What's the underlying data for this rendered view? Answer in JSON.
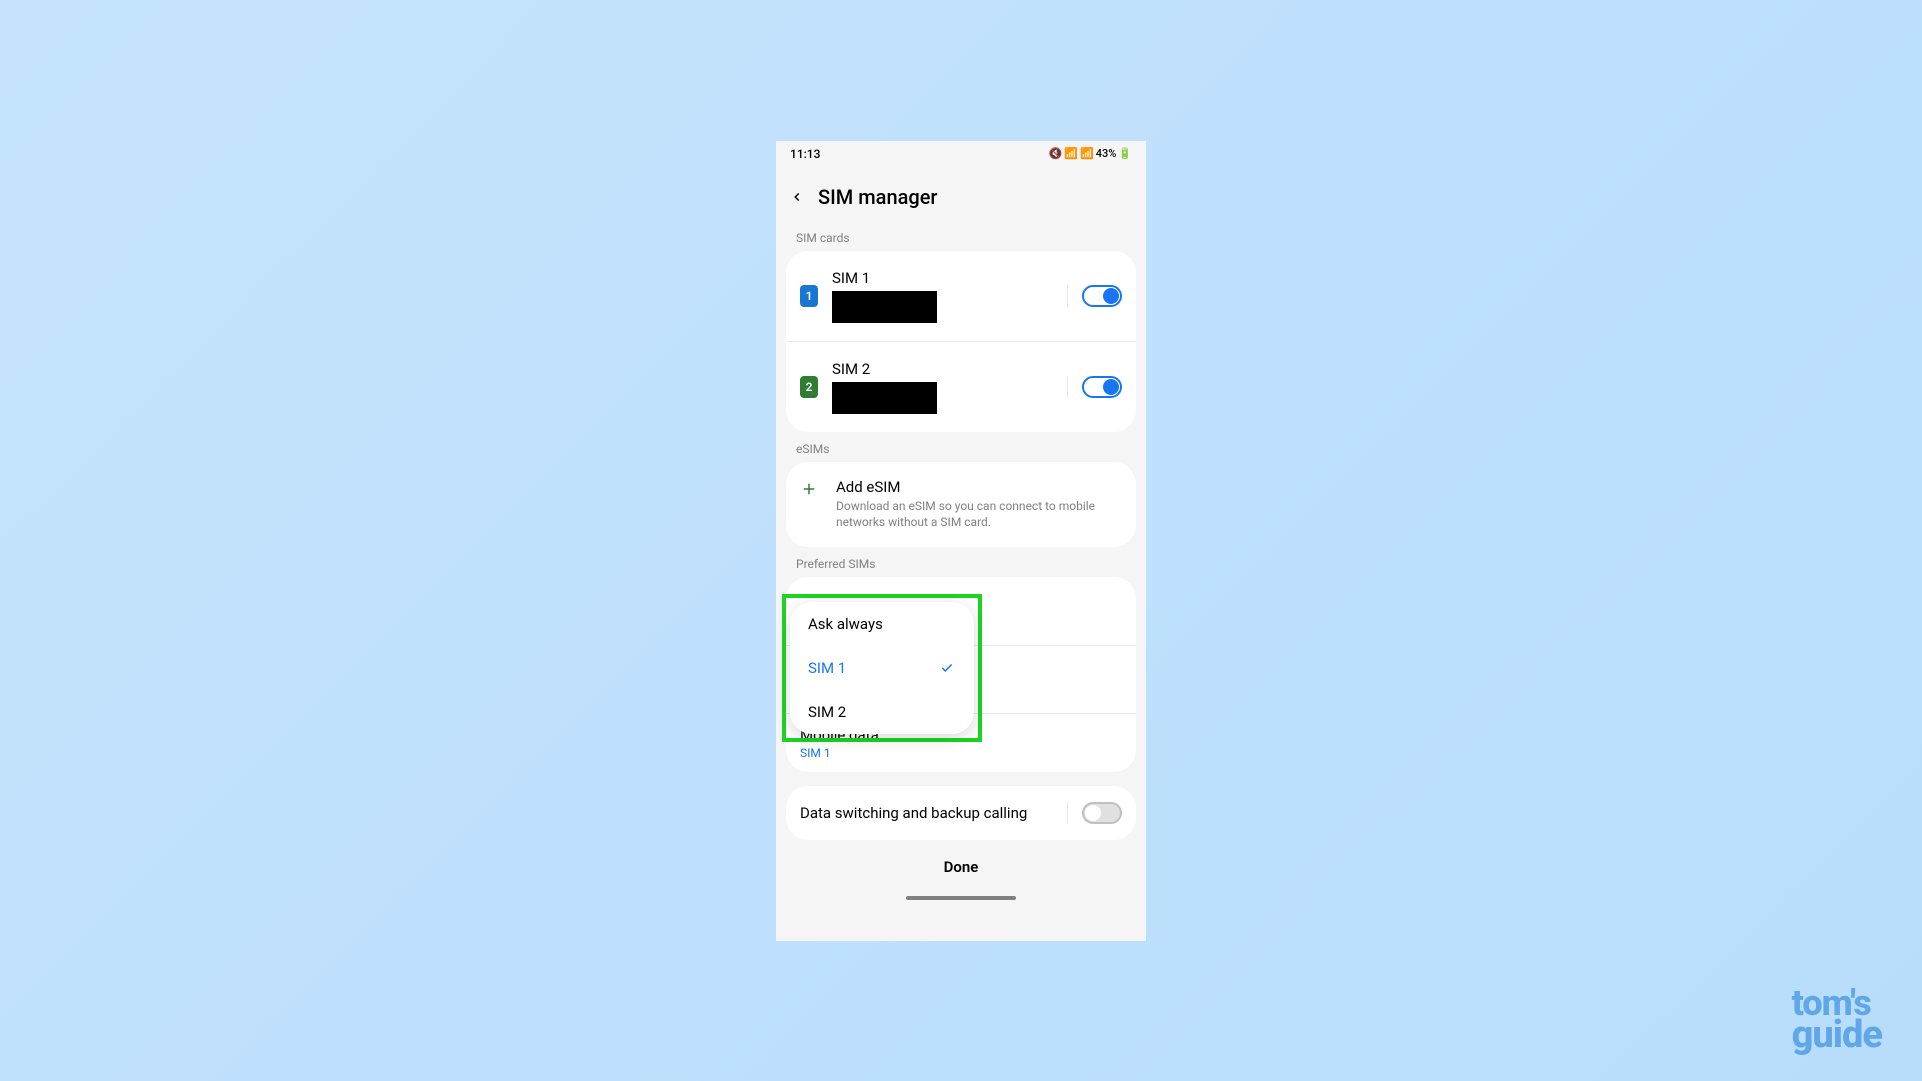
{
  "status": {
    "time": "11:13",
    "battery": "43%"
  },
  "header": {
    "title": "SIM manager"
  },
  "sections": {
    "sim_cards": "SIM cards",
    "esims": "eSIMs",
    "preferred": "Preferred SIMs"
  },
  "sims": [
    {
      "label": "SIM 1",
      "badge": "1",
      "enabled": true
    },
    {
      "label": "SIM 2",
      "badge": "2",
      "enabled": true
    }
  ],
  "esim": {
    "title": "Add eSIM",
    "desc": "Download an eSIM so you can connect to mobile networks without a SIM card."
  },
  "preferred": {
    "mobile_data": {
      "title": "Mobile data",
      "value": "SIM 1"
    }
  },
  "popup": {
    "items": [
      {
        "label": "Ask always",
        "selected": false
      },
      {
        "label": "SIM 1",
        "selected": true
      },
      {
        "label": "SIM 2",
        "selected": false
      }
    ]
  },
  "switching": {
    "label": "Data switching and backup calling",
    "enabled": false
  },
  "done": "Done",
  "watermark": {
    "line1": "tom's",
    "line2": "guide"
  }
}
